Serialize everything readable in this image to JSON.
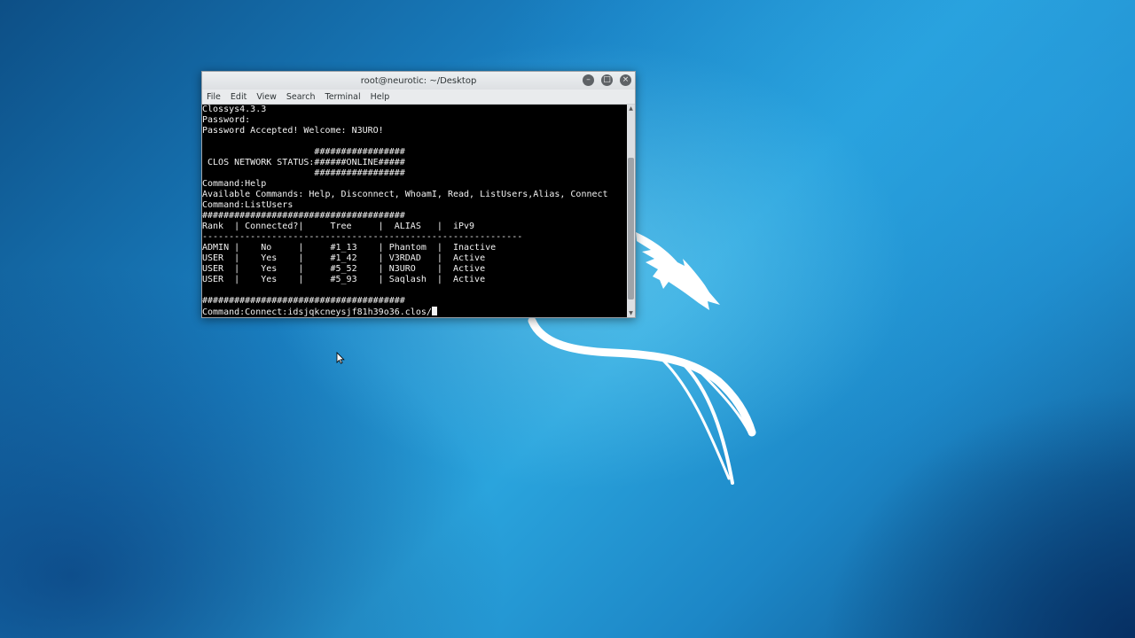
{
  "window": {
    "title": "root@neurotic: ~/Desktop",
    "controls": {
      "minimize_icon": "–",
      "maximize_icon": "□",
      "close_icon": "×"
    }
  },
  "menu": {
    "items": [
      "File",
      "Edit",
      "View",
      "Search",
      "Terminal",
      "Help"
    ]
  },
  "terminal": {
    "lines": [
      "Clossys4.3.3",
      "Password:",
      "Password Accepted! Welcome: N3URO!",
      "",
      "                     #################",
      " CLOS NETWORK STATUS:######ONLINE#####",
      "                     #################",
      "Command:Help",
      "Available Commands: Help, Disconnect, WhoamI, Read, ListUsers,Alias, Connect",
      "Command:ListUsers",
      "######################################",
      "Rank  | Connected?|     Tree     |  ALIAS   |  iPv9",
      "------------------------------------------------------------",
      "ADMIN |    No     |     #1_13    | Phantom  |  Inactive",
      "USER  |    Yes    |     #1_42    | V3RDAD   |  Active",
      "USER  |    Yes    |     #5_52    | N3URO    |  Active",
      "USER  |    Yes    |     #5_93    | Saqlash  |  Active",
      "",
      "######################################"
    ],
    "prompt_line": "Command:Connect:idsjqkcneysjf81h39o36.clos/"
  },
  "colors": {
    "terminal_bg": "#000000",
    "terminal_fg": "#f2f2f2",
    "desktop_accent": "#1a82c4"
  }
}
